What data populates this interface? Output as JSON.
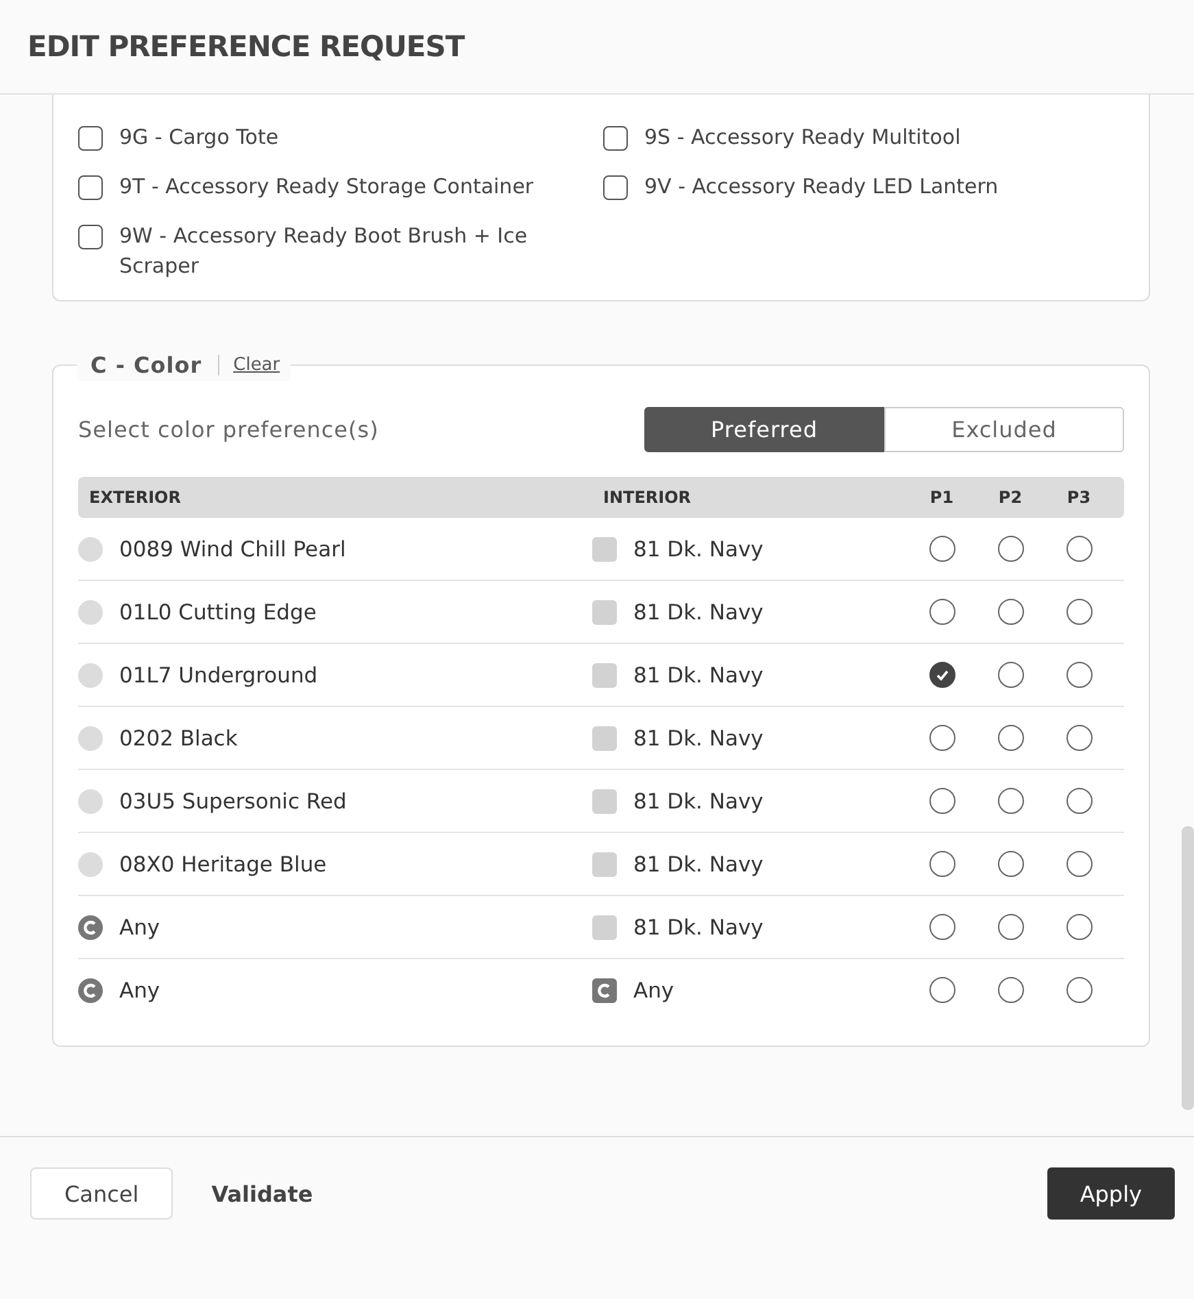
{
  "dialog": {
    "title": "EDIT PREFERENCE REQUEST"
  },
  "accessories": [
    {
      "label": "9G - Cargo Tote",
      "checked": false
    },
    {
      "label": "9S - Accessory Ready Multitool",
      "checked": false
    },
    {
      "label": "9T - Accessory Ready Storage Container",
      "checked": false
    },
    {
      "label": "9V - Accessory Ready LED Lantern",
      "checked": false
    },
    {
      "label": "9W - Accessory Ready Boot Brush + Ice Scraper",
      "checked": false
    }
  ],
  "color_section": {
    "legend": "C - Color",
    "clear_link": "Clear",
    "prompt": "Select color preference(s)",
    "modes": [
      {
        "label": "Preferred",
        "selected": true
      },
      {
        "label": "Excluded",
        "selected": false
      }
    ],
    "columns": [
      "EXTERIOR",
      "INTERIOR",
      "P1",
      "P2",
      "P3"
    ],
    "rows": [
      {
        "exterior": {
          "kind": "swatch",
          "label": "0089 Wind Chill Pearl"
        },
        "interior": {
          "kind": "swatch",
          "label": "81 Dk. Navy"
        },
        "priorities": [
          {
            "selected": false
          },
          {
            "selected": false
          },
          {
            "selected": false
          }
        ]
      },
      {
        "exterior": {
          "kind": "swatch",
          "label": "01L0 Cutting Edge"
        },
        "interior": {
          "kind": "swatch",
          "label": "81 Dk. Navy"
        },
        "priorities": [
          {
            "selected": false
          },
          {
            "selected": false
          },
          {
            "selected": false
          }
        ]
      },
      {
        "exterior": {
          "kind": "swatch",
          "label": "01L7 Underground"
        },
        "interior": {
          "kind": "swatch",
          "label": "81 Dk. Navy"
        },
        "priorities": [
          {
            "selected": true
          },
          {
            "selected": false
          },
          {
            "selected": false
          }
        ]
      },
      {
        "exterior": {
          "kind": "swatch",
          "label": "0202 Black"
        },
        "interior": {
          "kind": "swatch",
          "label": "81 Dk. Navy"
        },
        "priorities": [
          {
            "selected": false
          },
          {
            "selected": false
          },
          {
            "selected": false
          }
        ]
      },
      {
        "exterior": {
          "kind": "swatch",
          "label": "03U5 Supersonic Red"
        },
        "interior": {
          "kind": "swatch",
          "label": "81 Dk. Navy"
        },
        "priorities": [
          {
            "selected": false
          },
          {
            "selected": false
          },
          {
            "selected": false
          }
        ]
      },
      {
        "exterior": {
          "kind": "swatch",
          "label": "08X0 Heritage Blue"
        },
        "interior": {
          "kind": "swatch",
          "label": "81 Dk. Navy"
        },
        "priorities": [
          {
            "selected": false
          },
          {
            "selected": false
          },
          {
            "selected": false
          }
        ]
      },
      {
        "exterior": {
          "kind": "any",
          "label": "Any"
        },
        "interior": {
          "kind": "swatch",
          "label": "81 Dk. Navy"
        },
        "priorities": [
          {
            "selected": false
          },
          {
            "selected": false
          },
          {
            "selected": false
          }
        ]
      },
      {
        "exterior": {
          "kind": "any",
          "label": "Any"
        },
        "interior": {
          "kind": "any",
          "label": "Any"
        },
        "priorities": [
          {
            "selected": false
          },
          {
            "selected": false
          },
          {
            "selected": false
          }
        ]
      }
    ]
  },
  "footer": {
    "buttons": [
      {
        "label": "Cancel",
        "kind": "outline"
      },
      {
        "label": "Validate",
        "kind": "text"
      },
      {
        "label": "Apply",
        "kind": "primary"
      }
    ]
  }
}
